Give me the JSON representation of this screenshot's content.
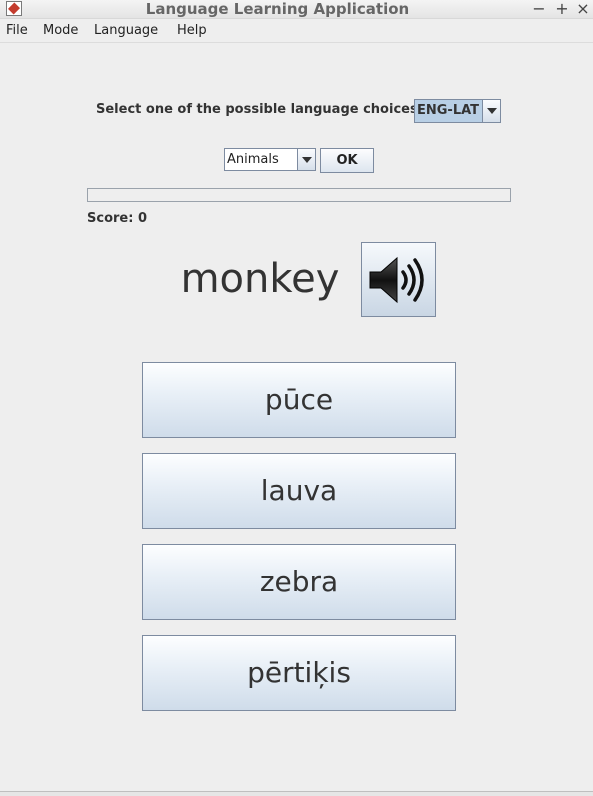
{
  "window": {
    "title": "Language Learning Application",
    "controls": {
      "minimize": "−",
      "maximize": "+",
      "close": "×"
    }
  },
  "menu": {
    "items": [
      "File",
      "Mode",
      "Language",
      "Help"
    ]
  },
  "language": {
    "prompt": "Select one of the possible language choices",
    "selected": "ENG-LAT"
  },
  "category": {
    "selected": "Animals",
    "ok_label": "OK"
  },
  "progress": {
    "fraction": 0
  },
  "score": {
    "label": "Score:",
    "value": "0"
  },
  "question": {
    "word": "monkey",
    "sound_icon": "speaker-icon"
  },
  "answers": [
    "pūce",
    "lauva",
    "zebra",
    "pērtiķis"
  ]
}
